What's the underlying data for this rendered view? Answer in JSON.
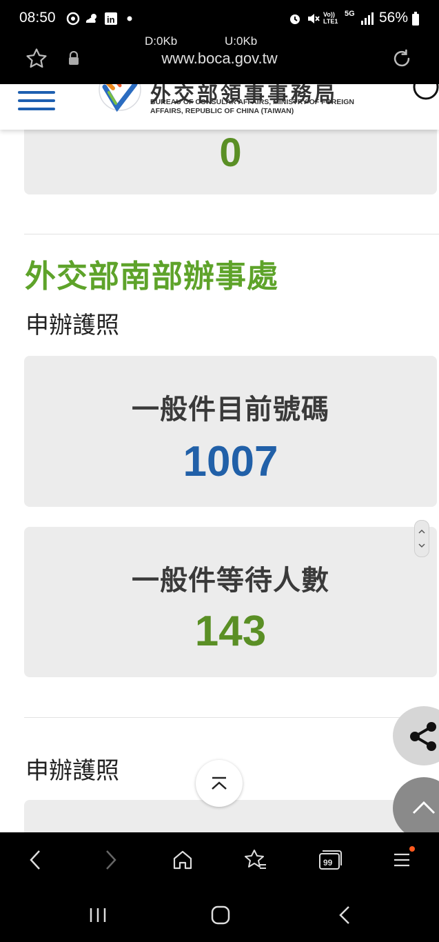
{
  "status_bar": {
    "time": "08:50",
    "battery": "56%",
    "net_down": "D:0Kb",
    "net_up": "U:0Kb",
    "icons": [
      "signal-app-icon",
      "weather-icon",
      "linkedin-icon",
      "dot-icon",
      "alarm-icon",
      "mute-icon",
      "volte-icon",
      "5g-icon",
      "signal-bars-icon",
      "battery-icon"
    ],
    "volte_label": "Vo)) LTE1",
    "net_label": "5G"
  },
  "browser": {
    "url": "www.boca.gov.tw"
  },
  "header": {
    "logo_cn": "外交部領事事務局",
    "logo_en_line1": "BUREAU OF CONSULAR AFFAIRS, MINISTRY OF FOREIGN",
    "logo_en_line2": "AFFAIRS, REPUBLIC OF CHINA (TAIWAN)"
  },
  "prev_card": {
    "value": "0"
  },
  "office": {
    "title": "外交部南部辦事處",
    "section_label": "申辦護照",
    "current_number": {
      "label": "一般件目前號碼",
      "value": "1007"
    },
    "waiting_count": {
      "label": "一般件等待人數",
      "value": "143"
    }
  },
  "next_section": {
    "label": "申辦護照"
  },
  "colors": {
    "accent_green": "#5ea32a",
    "count_green": "#5a8f25",
    "number_blue": "#2160a8",
    "nav_blue": "#1d5fb0",
    "card_bg": "#ececec"
  },
  "toolbar": {
    "tabs_count": "99"
  }
}
